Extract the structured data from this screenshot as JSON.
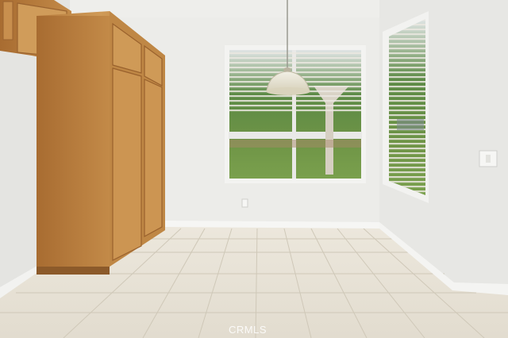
{
  "photo": {
    "watermark": "CRMLS"
  },
  "colors": {
    "wall": "#ebebe9",
    "floor_tile": "#e7e2d6",
    "cabinet_wood": "#c8914f",
    "outdoor_green": "#4f7a3c"
  }
}
